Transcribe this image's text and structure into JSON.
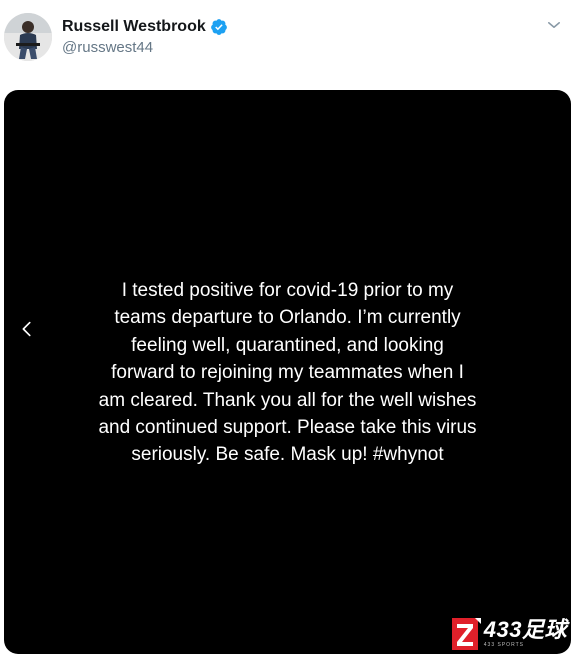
{
  "user": {
    "display_name": "Russell Westbrook",
    "handle": "@russwest44",
    "verified": true,
    "avatar_icon": "profile-photo"
  },
  "icons": {
    "verified": "verified-badge-icon",
    "menu": "chevron-down-icon",
    "prev": "chevron-left-icon"
  },
  "media": {
    "statement": "I tested positive for covid-19 prior to my\nteams departure to Orlando. I’m currently\nfeeling well, quarantined, and looking\nforward to rejoining my teammates when I\nam cleared. Thank you all for the well wishes\nand continued support. Please take this virus\nseriously. Be safe. Mask up! #whynot"
  },
  "watermark": {
    "text": "433足球",
    "subtext": "433 SPORTS"
  },
  "colors": {
    "verified_blue": "#1da1f2",
    "name": "#14171a",
    "handle": "#657786",
    "media_bg": "#000000",
    "watermark_red": "#e0202a"
  }
}
